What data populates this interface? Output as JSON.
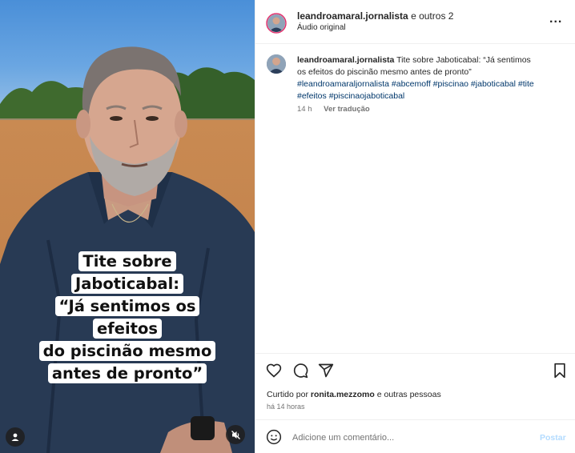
{
  "post": {
    "header": {
      "username": "leandroamaral.jornalista",
      "collab_text": "e outros 2",
      "audio_label": "Áudio original",
      "more_label": "..."
    },
    "video": {
      "caption_lines": [
        "Tite sobre Jaboticabal:",
        "“Já sentimos os efeitos",
        "do piscinão mesmo",
        "antes de pronto”"
      ]
    },
    "caption": {
      "username": "leandroamaral.jornalista",
      "text": "Tite sobre Jaboticabal: “Já sentimos os efeitos do piscinão mesmo antes de pronto”",
      "hashtags": "#leandroamaraljornalista #abcemoff #piscinao #jaboticabal #tite #efeitos #piscinaojaboticabal",
      "age": "14 h",
      "translate_label": "Ver tradução"
    },
    "likes": {
      "prefix": "Curtido por",
      "user": "ronita.mezzomo",
      "suffix": "e outras pessoas"
    },
    "timestamp": "há 14 horas",
    "add_comment": {
      "placeholder": "Adicione um comentário...",
      "post_label": "Postar"
    }
  },
  "colors": {
    "link": "#00376b",
    "muted": "#737373",
    "post_disabled": "#b3dbff",
    "story_ring": "#e1306c"
  },
  "icons": [
    "user-tag-icon",
    "mute-icon",
    "more-icon",
    "heart-icon",
    "comment-icon",
    "share-icon",
    "bookmark-icon",
    "emoji-icon"
  ]
}
